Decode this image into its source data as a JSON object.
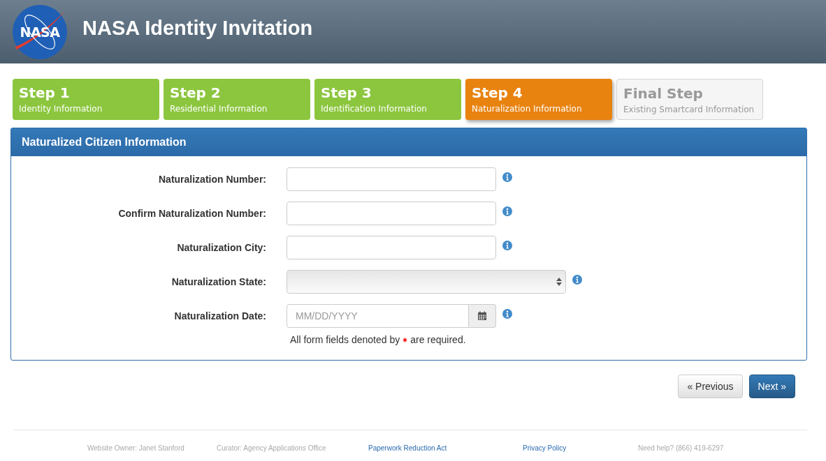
{
  "header": {
    "title": "NASA Identity Invitation",
    "logo_text": "NASA"
  },
  "steps": [
    {
      "title": "Step 1",
      "subtitle": "Identity Information",
      "disabled": false,
      "selected": false
    },
    {
      "title": "Step 2",
      "subtitle": "Residential Information",
      "disabled": false,
      "selected": false
    },
    {
      "title": "Step 3",
      "subtitle": "Identification Information",
      "disabled": false,
      "selected": false
    },
    {
      "title": "Step 4",
      "subtitle": "Naturalization Information",
      "disabled": false,
      "selected": true
    },
    {
      "title": "Final Step",
      "subtitle": "Existing Smartcard Information",
      "disabled": true,
      "selected": false
    }
  ],
  "panel": {
    "title": "Naturalized Citizen Information",
    "fields": [
      {
        "label": "Naturalization Number:",
        "kind": "text"
      },
      {
        "label": "Confirm Naturalization Number:",
        "kind": "text"
      },
      {
        "label": "Naturalization City:",
        "kind": "text"
      },
      {
        "label": "Naturalization State:",
        "kind": "select"
      },
      {
        "label": "Naturalization Date:",
        "kind": "date",
        "placeholder": "MM/DD/YYYY"
      }
    ],
    "note_before": "All form fields denoted by",
    "note_after": "are required."
  },
  "buttons": [
    {
      "label": "« Previous",
      "kind": "default"
    },
    {
      "label": "Next »",
      "kind": "primary"
    }
  ],
  "footer": [
    {
      "text": "Website Owner: Janet Stanford",
      "kind": "text"
    },
    {
      "text": "Curator: Agency Applications Office",
      "kind": "text"
    },
    {
      "text": "Paperwork Reduction Act",
      "kind": "link"
    },
    {
      "text": "Privacy Policy",
      "kind": "link"
    },
    {
      "text": "Need help? (866) 419-6297",
      "kind": "text"
    }
  ]
}
